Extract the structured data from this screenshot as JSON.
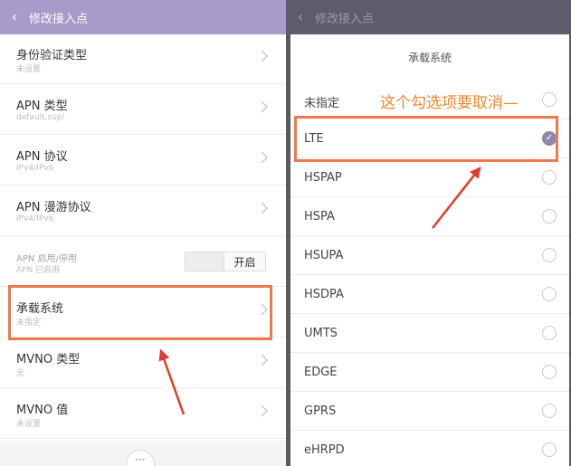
{
  "left": {
    "header_title": "修改接入点",
    "items": [
      {
        "title": "身份验证类型",
        "sub": "未设置"
      },
      {
        "title": "APN 类型",
        "sub": "default,supl"
      },
      {
        "title": "APN 协议",
        "sub": "IPv4/IPv6"
      },
      {
        "title": "APN 漫游协议",
        "sub": "IPv4/IPv6"
      },
      {
        "title": "APN 启用/停用",
        "sub": "APN 已启用",
        "toggle_label": "开启"
      },
      {
        "title": "承载系统",
        "sub": "未指定"
      },
      {
        "title": "MVNO 类型",
        "sub": "无"
      },
      {
        "title": "MVNO 值",
        "sub": "未设置"
      }
    ],
    "more_label": "···"
  },
  "right": {
    "header_title": "修改接入点",
    "dialog_title": "承载系统",
    "annotation": "这个勾选项要取消—",
    "options": [
      "未指定",
      "LTE",
      "HSPAP",
      "HSPA",
      "HSUPA",
      "HSDPA",
      "UMTS",
      "EDGE",
      "GPRS",
      "eHRPD"
    ],
    "selected": "LTE"
  },
  "colors": {
    "left_header": "#a79bc9",
    "right_header_dimmed": "#5f5a6e",
    "highlight_box": "#ed7a4e",
    "annotation_text": "#f0862d",
    "arrow": "#e23a2b",
    "radio_checked": "#8f87ad"
  },
  "icons": {
    "back": "chevron-left-icon",
    "row_nav": "chevron-right-icon",
    "radio_checked": "check-icon"
  }
}
